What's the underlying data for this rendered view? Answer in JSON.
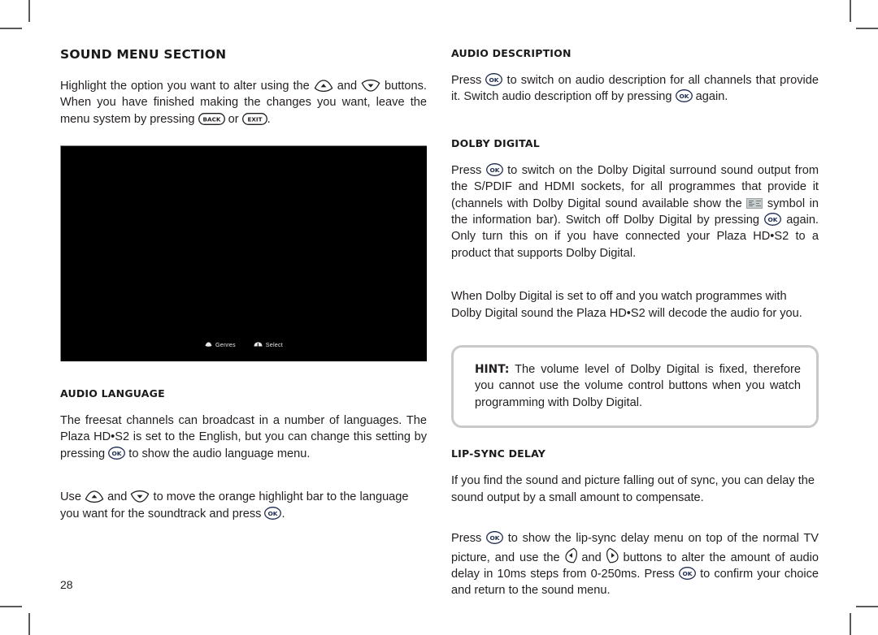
{
  "page": {
    "folio": "28",
    "left_column": {
      "section_title": "SOUND MENU SECTION",
      "intro_1": "Highlight the option you want to alter using the ",
      "intro_2": " and ",
      "intro_3": " buttons. When you have finished making the changes you want, leave the menu system by pressing ",
      "intro_4": " or ",
      "intro_5": ".",
      "tv_screenshot": {
        "osd_items": [
          {
            "icon": "up-down-button-icon",
            "label": "Genres"
          },
          {
            "icon": "ok-button-icon",
            "label": "Select"
          }
        ]
      },
      "audio_language": {
        "heading": "AUDIO LANGUAGE",
        "para1_a": "The freesat channels can broadcast in a number of languages. The Plaza HD•S2 is set to the English, but you can change this setting by pressing ",
        "para1_b": " to show the audio language menu.",
        "para2_a": "Use ",
        "para2_b": " and ",
        "para2_c": " to move the orange highlight bar to the language you want for the soundtrack and press ",
        "para2_d": "."
      }
    },
    "right_column": {
      "audio_description": {
        "heading": "AUDIO DESCRIPTION",
        "para_a": "Press ",
        "para_b": " to switch on audio description for all channels that provide it. Switch audio description off by pressing ",
        "para_c": " again."
      },
      "dolby_digital": {
        "heading": "DOLBY DIGITAL",
        "para1_a": "Press ",
        "para1_b": " to switch on the Dolby Digital surround sound output from the S/PDIF and HDMI sockets, for all programmes that provide it (channels with Dolby Digital sound available show the ",
        "para1_c": " symbol in the information bar). Switch off Dolby Digital by pressing ",
        "para1_d": " again. Only turn this on if you have connected your Plaza HD•S2 to a product that supports Dolby Digital.",
        "para2": "When Dolby Digital is set to off and you watch programmes with Dolby Digital sound the Plaza HD•S2 will decode the audio for you."
      },
      "hint": {
        "label": "HINT:",
        "text": " The volume level of Dolby Digital is fixed, therefore you cannot use the volume control buttons when you watch programming with Dolby Digital."
      },
      "lip_sync_delay": {
        "heading": "LIP-SYNC DELAY",
        "para1": "If you find the sound and picture falling out of sync, you can delay the sound output by a small amount to compensate.",
        "para2_a": "Press ",
        "para2_b": " to show the lip-sync delay menu on top of the normal TV picture, and use the ",
        "para2_c": " and ",
        "para2_d": " buttons to alter the amount of audio delay in 10ms steps from 0-250ms. Press ",
        "para2_e": " to confirm your choice and return to the sound menu."
      }
    },
    "keys": {
      "ok": "OK",
      "back": "BACK",
      "exit": "EXIT",
      "up": "up-arrow-button",
      "down": "down-arrow-button",
      "left": "left-arrow-button",
      "right": "right-arrow-button"
    },
    "colors": {
      "text": "#231f20",
      "heading": "#1a1a1a",
      "hint_border": "#c9c9c9",
      "crop_mark": "#58595b",
      "screenshot_bg": "#000000"
    }
  }
}
